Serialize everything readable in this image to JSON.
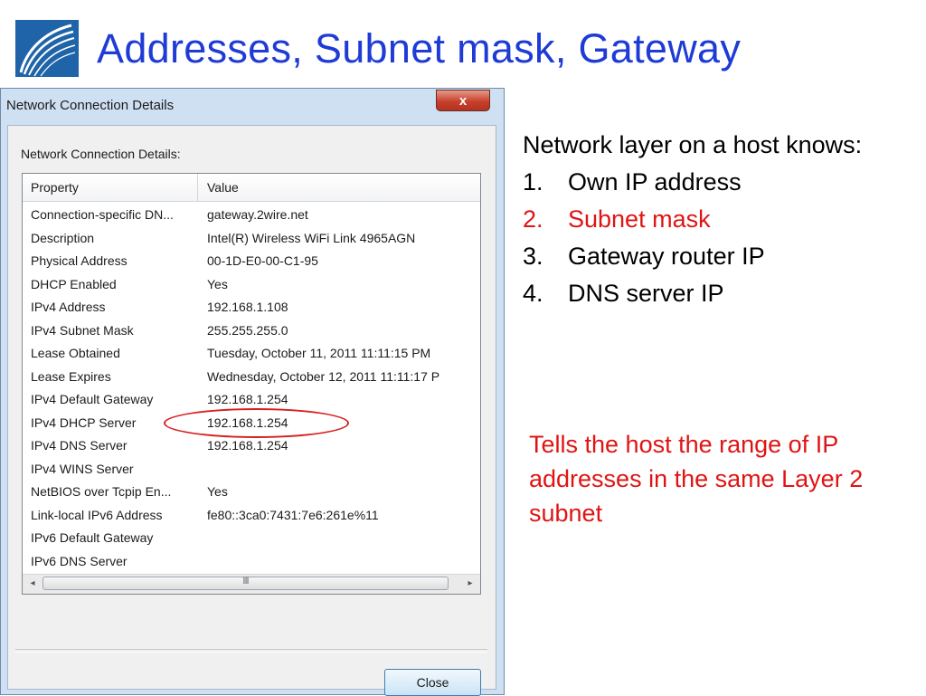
{
  "slide": {
    "title": "Addresses, Subnet mask, Gateway",
    "logo_icon": "swoosh-logo-icon"
  },
  "dialog": {
    "title": "Network Connection Details",
    "close_x": "x",
    "group_label": "Network Connection Details:",
    "columns": {
      "property": "Property",
      "value": "Value"
    },
    "rows": [
      {
        "property": "Connection-specific DN...",
        "value": "gateway.2wire.net"
      },
      {
        "property": "Description",
        "value": "Intel(R) Wireless WiFi Link 4965AGN"
      },
      {
        "property": "Physical Address",
        "value": "00-1D-E0-00-C1-95"
      },
      {
        "property": "DHCP Enabled",
        "value": "Yes"
      },
      {
        "property": "IPv4 Address",
        "value": "192.168.1.108"
      },
      {
        "property": "IPv4 Subnet Mask",
        "value": "255.255.255.0"
      },
      {
        "property": "Lease Obtained",
        "value": "Tuesday, October 11, 2011 11:11:15 PM"
      },
      {
        "property": "Lease Expires",
        "value": "Wednesday, October 12, 2011 11:11:17 P"
      },
      {
        "property": "IPv4 Default Gateway",
        "value": "192.168.1.254"
      },
      {
        "property": "IPv4 DHCP Server",
        "value": "192.168.1.254"
      },
      {
        "property": "IPv4 DNS Server",
        "value": "192.168.1.254"
      },
      {
        "property": "IPv4 WINS Server",
        "value": ""
      },
      {
        "property": "NetBIOS over Tcpip En...",
        "value": "Yes"
      },
      {
        "property": "Link-local IPv6 Address",
        "value": "fe80::3ca0:7431:7e6:261e%11"
      },
      {
        "property": "IPv6 Default Gateway",
        "value": ""
      },
      {
        "property": "IPv6 DNS Server",
        "value": ""
      }
    ],
    "scroll": {
      "left": "◂",
      "right": "▸",
      "grip": "III"
    },
    "close_button": "Close",
    "highlight_color": "#d71e1e"
  },
  "notes": {
    "intro": "Network layer on a host knows:",
    "items": [
      {
        "num": "1.",
        "text": "Own IP address"
      },
      {
        "num": "2.",
        "text": "Subnet mask"
      },
      {
        "num": "3.",
        "text": "Gateway router IP"
      },
      {
        "num": "4.",
        "text": "DNS server IP"
      }
    ],
    "explanation": "Tells the host the range of IP addresses in the same Layer 2 subnet",
    "accent_color": "#e01414"
  }
}
